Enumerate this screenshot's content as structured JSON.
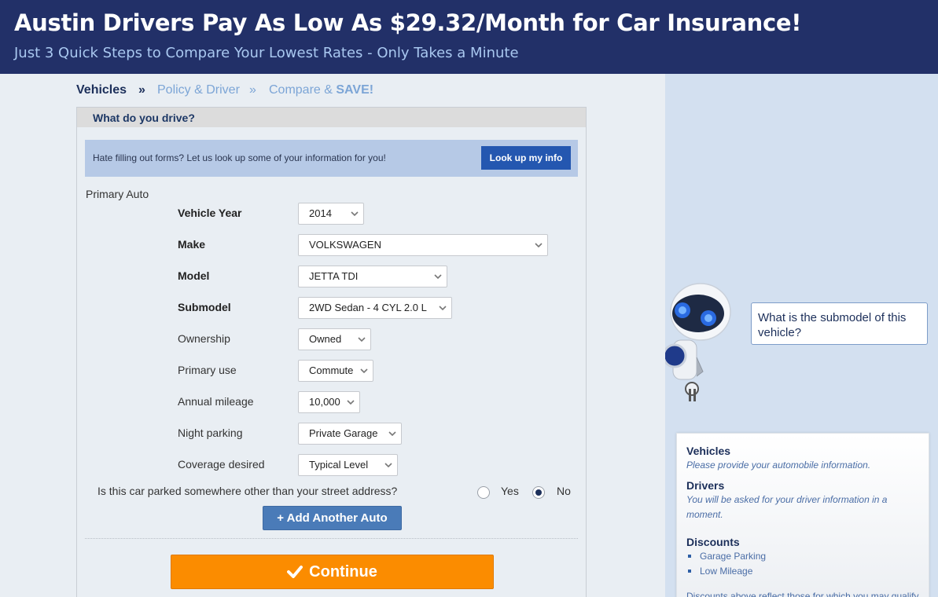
{
  "header": {
    "title": "Austin Drivers Pay As Low As $29.32/Month for Car Insurance!",
    "subtitle": "Just 3 Quick Steps to Compare Your Lowest Rates - Only Takes a Minute"
  },
  "steps": {
    "step1": "Vehicles",
    "sep": "»",
    "step2": "Policy & Driver",
    "step3_prefix": "Compare & ",
    "step3_bold": "SAVE!"
  },
  "form": {
    "heading": "What do you drive?",
    "lookup_text": "Hate filling out forms? Let us look up some of your information for you!",
    "lookup_button": "Look up my info",
    "section_label": "Primary Auto",
    "fields": [
      {
        "label": "Vehicle Year",
        "value": "2014"
      },
      {
        "label": "Make",
        "value": "VOLKSWAGEN"
      },
      {
        "label": "Model",
        "value": "JETTA TDI"
      },
      {
        "label": "Submodel",
        "value": "2WD Sedan - 4 CYL 2.0 L"
      },
      {
        "label": "Ownership",
        "value": "Owned"
      },
      {
        "label": "Primary use",
        "value": "Commute"
      },
      {
        "label": "Annual mileage",
        "value": "10,000"
      },
      {
        "label": "Night parking",
        "value": "Private Garage"
      },
      {
        "label": "Coverage desired",
        "value": "Typical Level"
      }
    ],
    "parked_question": "Is this car parked somewhere other than your street address?",
    "radio_yes": "Yes",
    "radio_no": "No",
    "radio_selected": "No",
    "add_button": "+ Add Another Auto",
    "continue_button": "Continue"
  },
  "assistant": {
    "bubble_text": "What is the submodel of this vehicle?"
  },
  "summary": {
    "vehicles_title": "Vehicles",
    "vehicles_text": "Please provide your automobile information.",
    "drivers_title": "Drivers",
    "drivers_text_1": "You will be asked for your driver information in a",
    "drivers_text_2": "moment.",
    "discounts_title": "Discounts",
    "discounts": [
      "Garage Parking",
      "Low Mileage"
    ],
    "footer_text": "Discounts above reflect those for which you may qualify."
  },
  "colors": {
    "header_bg": "#223068",
    "accent_blue": "#2457b0",
    "continue_orange": "#fb8c00",
    "right_panel": "#d3e0f0"
  }
}
